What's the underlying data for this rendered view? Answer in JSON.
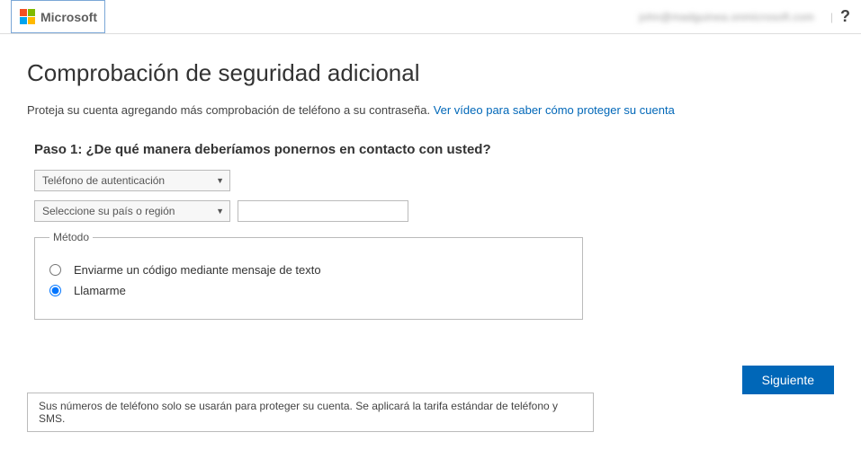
{
  "header": {
    "brand": "Microsoft",
    "user_email": "john@madguinea.onmicrosoft.com",
    "help": "?"
  },
  "page": {
    "title": "Comprobación de seguridad adicional",
    "intro_text": "Proteja su cuenta agregando más comprobación de teléfono a su contraseña. ",
    "intro_link": "Ver vídeo para saber cómo proteger su cuenta"
  },
  "step1": {
    "label": "Paso 1: ¿De qué manera deberíamos ponernos en contacto con usted?",
    "method_select": "Teléfono de autenticación",
    "country_select": "Seleccione su país o región",
    "phone_value": ""
  },
  "method": {
    "legend": "Método",
    "option_sms": "Enviarme un código mediante mensaje de texto",
    "option_call": "Llamarme",
    "selected": "call"
  },
  "actions": {
    "next": "Siguiente"
  },
  "disclaimer": "Sus números de teléfono solo se usarán para proteger su cuenta. Se aplicará la tarifa estándar de teléfono y SMS."
}
